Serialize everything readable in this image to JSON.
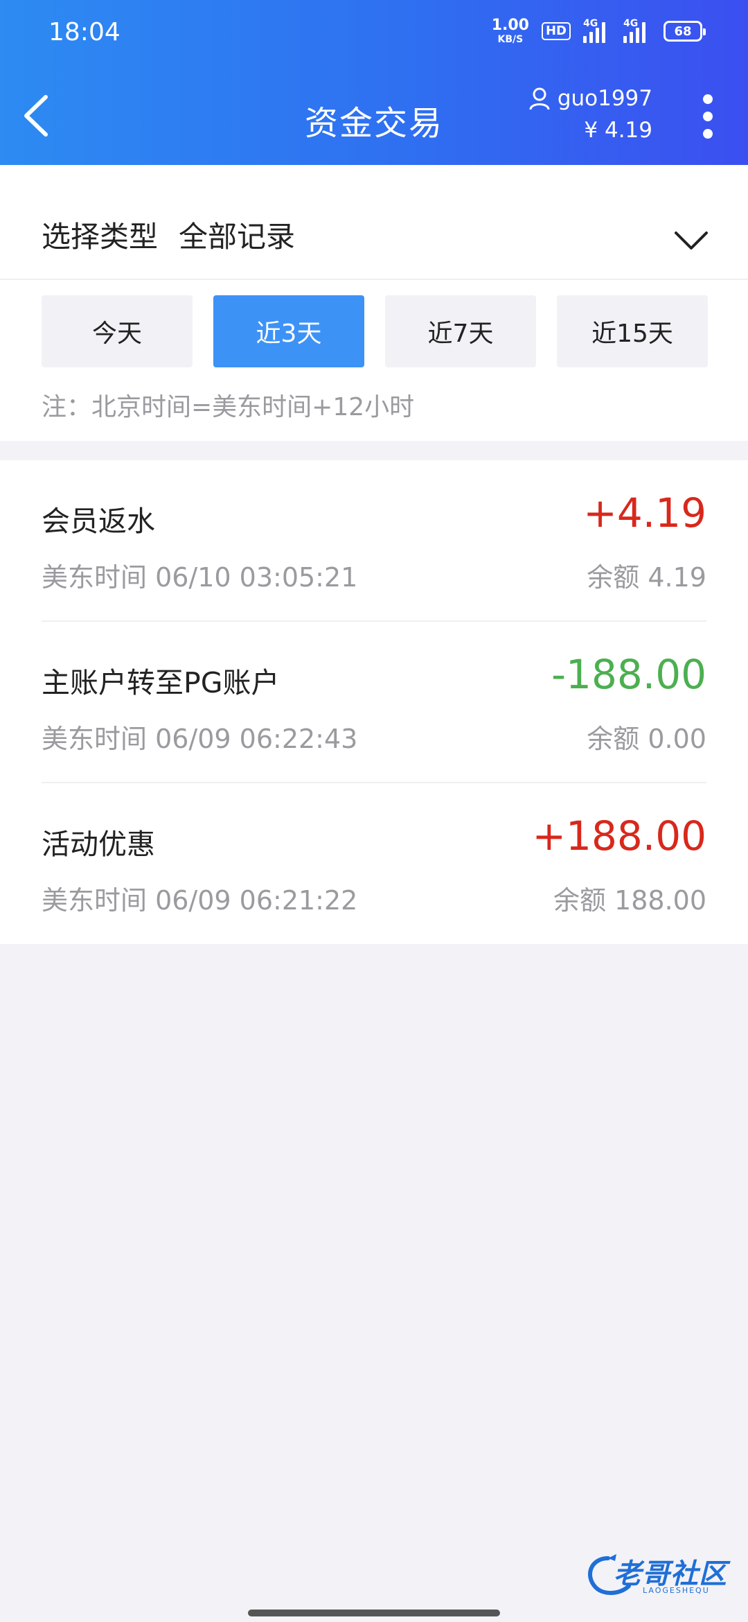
{
  "status_bar": {
    "time": "18:04",
    "net_speed_value": "1.00",
    "net_speed_unit": "KB/S",
    "hd_label": "HD",
    "sim1_label": "4G",
    "sim2_label": "4G",
    "battery": "68"
  },
  "header": {
    "title": "资金交易",
    "username": "guo1997",
    "balance": "¥ 4.19",
    "icons": [
      "back-icon",
      "user-icon",
      "more-vertical-icon"
    ]
  },
  "filter": {
    "type_label": "选择类型",
    "type_value": "全部记录",
    "ranges": [
      {
        "label": "今天",
        "active": false
      },
      {
        "label": "近3天",
        "active": true
      },
      {
        "label": "近7天",
        "active": false
      },
      {
        "label": "近15天",
        "active": false
      }
    ],
    "note": "注：北京时间=美东时间+12小时"
  },
  "transactions": [
    {
      "title": "会员返水",
      "time": "美东时间 06/10 03:05:21",
      "amount": "+4.19",
      "balance": "余额 4.19",
      "direction": "in"
    },
    {
      "title": "主账户转至PG账户",
      "time": "美东时间 06/09 06:22:43",
      "amount": "-188.00",
      "balance": "余额 0.00",
      "direction": "out"
    },
    {
      "title": "活动优惠",
      "time": "美东时间 06/09 06:21:22",
      "amount": "+188.00",
      "balance": "余额 188.00",
      "direction": "in"
    }
  ],
  "watermark": {
    "text": "老哥社区",
    "sub": "LAOGESHEQU"
  },
  "colors": {
    "header_start": "#2d8bf2",
    "header_end": "#3b4ff0",
    "accent": "#3d92f6",
    "positive": "#d8281c",
    "negative": "#4caf50"
  }
}
